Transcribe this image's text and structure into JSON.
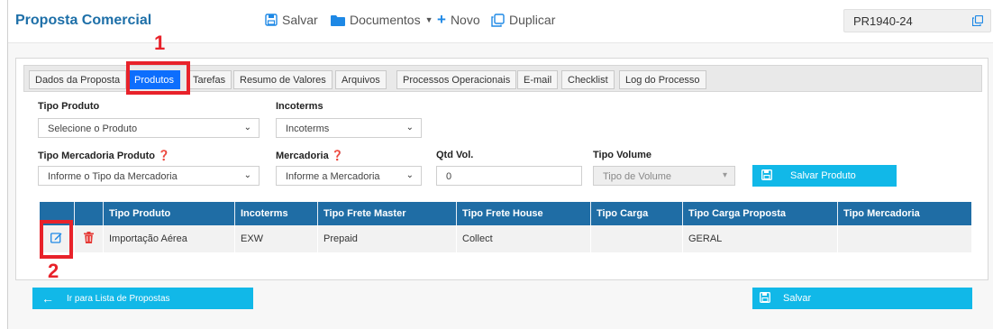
{
  "header": {
    "title": "Proposta Comercial",
    "save": "Salvar",
    "documents": "Documentos",
    "new": "Novo",
    "duplicate": "Duplicar",
    "code": "PR1940-24"
  },
  "tabs": [
    {
      "label": "Dados da Proposta",
      "active": false
    },
    {
      "label": "Produtos",
      "active": true
    },
    {
      "label": "Tarefas",
      "active": false
    },
    {
      "label": "Resumo de Valores",
      "active": false
    },
    {
      "label": "Arquivos",
      "active": false
    },
    {
      "label": "Processos Operacionais",
      "active": false
    },
    {
      "label": "E-mail",
      "active": false
    },
    {
      "label": "Checklist",
      "active": false
    },
    {
      "label": "Log do Processo",
      "active": false
    }
  ],
  "annotations": {
    "first": "1",
    "second": "2"
  },
  "form": {
    "tipo_produto": {
      "label": "Tipo Produto",
      "value": "Selecione o Produto"
    },
    "incoterms": {
      "label": "Incoterms",
      "value": "Incoterms"
    },
    "tipo_mercadoria_produto": {
      "label": "Tipo Mercadoria Produto",
      "value": "Informe o Tipo da Mercadoria"
    },
    "mercadoria": {
      "label": "Mercadoria",
      "value": "Informe a Mercadoria"
    },
    "qtd_vol": {
      "label": "Qtd Vol.",
      "value": "0"
    },
    "tipo_volume": {
      "label": "Tipo Volume",
      "value": "Tipo de Volume"
    },
    "salvar_produto": "Salvar Produto"
  },
  "table": {
    "headers": [
      "Tipo Produto",
      "Incoterms",
      "Tipo Frete Master",
      "Tipo Frete House",
      "Tipo Carga",
      "Tipo Carga Proposta",
      "Tipo Mercadoria"
    ],
    "rows": [
      [
        "Importação Aérea",
        "EXW",
        "Prepaid",
        "Collect",
        "",
        "GERAL",
        ""
      ]
    ]
  },
  "footer": {
    "back": "Ir para Lista de Propostas",
    "save": "Salvar"
  },
  "colors": {
    "brand": "#1d6fa8",
    "tab_active": "#0d6efd",
    "accent_cyan": "#11b8e8",
    "table_header": "#1f6da5",
    "annotation_red": "#e8222a"
  }
}
